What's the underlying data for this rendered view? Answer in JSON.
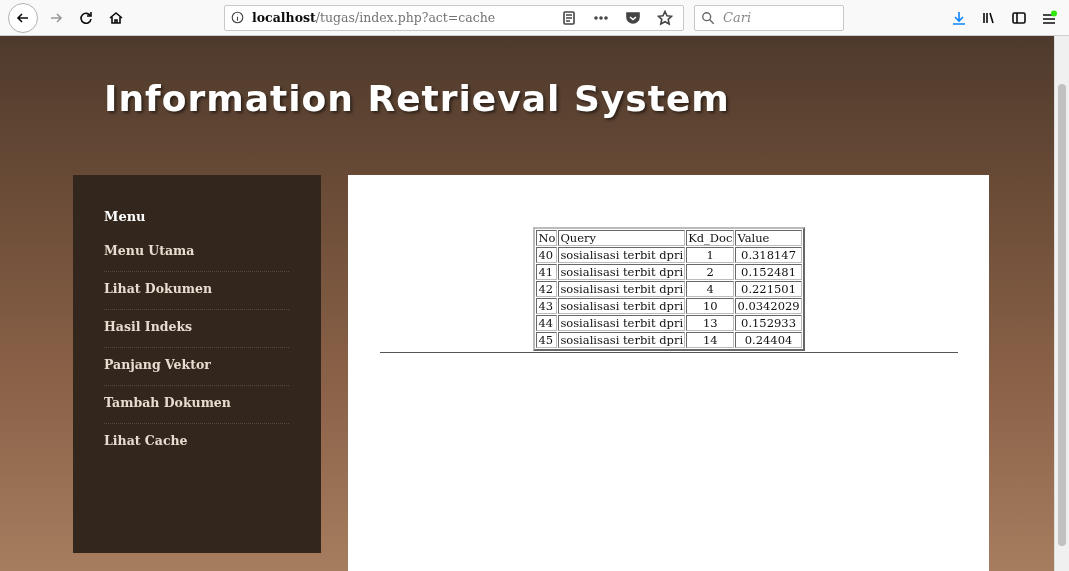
{
  "browser": {
    "url": "**localhost**/tugas/index.php?act=cache",
    "search_placeholder": "Cari"
  },
  "page": {
    "title": "Information Retrieval System",
    "sidebar": {
      "heading": "Menu",
      "items": [
        {
          "label": "Menu Utama"
        },
        {
          "label": "Lihat Dokumen"
        },
        {
          "label": "Hasil Indeks"
        },
        {
          "label": "Panjang Vektor"
        },
        {
          "label": "Tambah Dokumen"
        },
        {
          "label": "Lihat Cache"
        }
      ]
    },
    "table": {
      "columns": [
        "No",
        "Query",
        "Kd_Doc",
        "Value"
      ],
      "rows": [
        [
          "40",
          "sosialisasi terbit dpri",
          "1",
          "0.318147"
        ],
        [
          "41",
          "sosialisasi terbit dpri",
          "2",
          "0.152481"
        ],
        [
          "42",
          "sosialisasi terbit dpri",
          "4",
          "0.221501"
        ],
        [
          "43",
          "sosialisasi terbit dpri",
          "10",
          "0.0342029"
        ],
        [
          "44",
          "sosialisasi terbit dpri",
          "13",
          "0.152933"
        ],
        [
          "45",
          "sosialisasi terbit dpri",
          "14",
          "0.24404"
        ]
      ]
    }
  }
}
